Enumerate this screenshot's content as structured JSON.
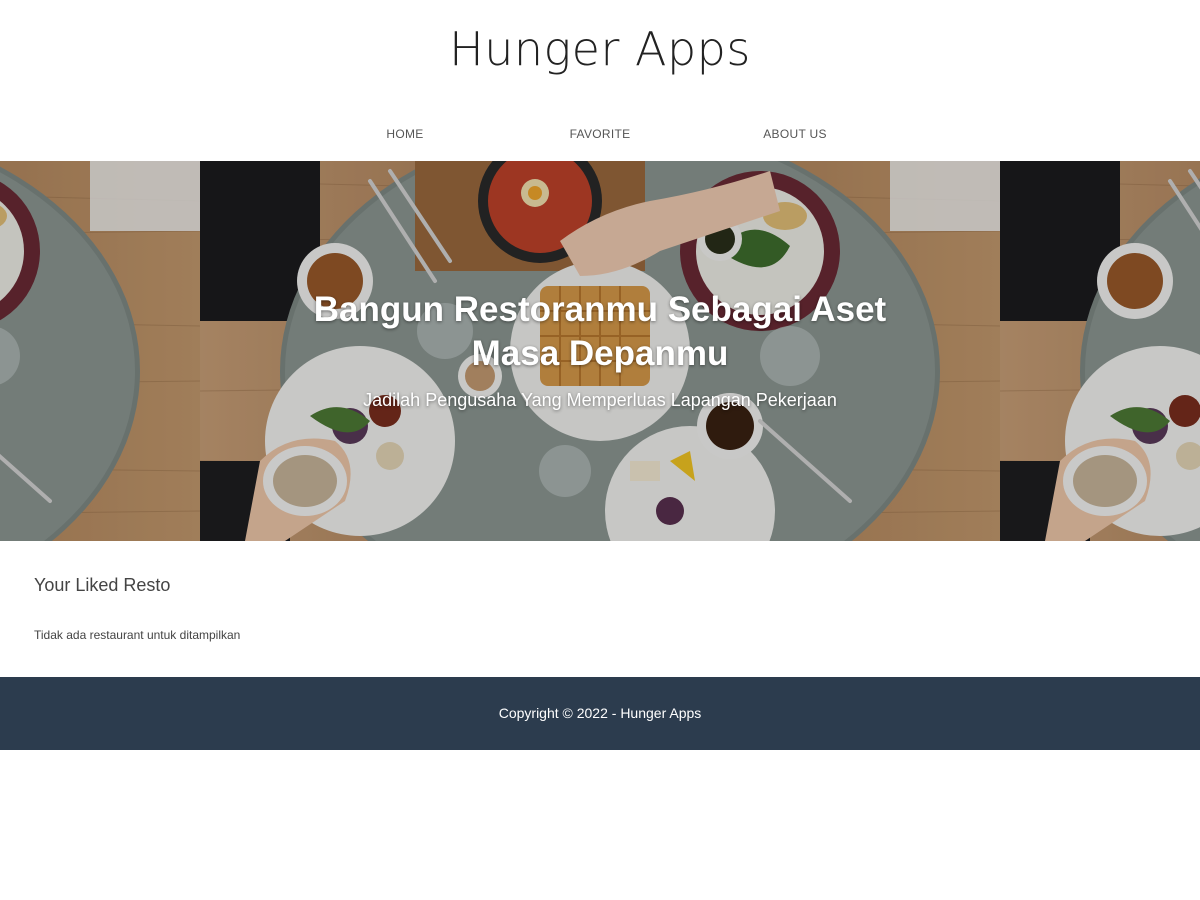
{
  "header": {
    "title": "Hunger Apps"
  },
  "nav": {
    "items": [
      {
        "label": "HOME"
      },
      {
        "label": "FAVORITE"
      },
      {
        "label": "ABOUT US"
      }
    ]
  },
  "hero": {
    "title": "Bangun Restoranmu Sebagai Aset Masa Depanmu",
    "subtitle": "Jadilah Pengusaha Yang Memperluas Lapangan Pekerjaan"
  },
  "main": {
    "heading": "Your Liked Resto",
    "empty_message": "Tidak ada restaurant untuk ditampilkan"
  },
  "footer": {
    "text": "Copyright © 2022 - Hunger Apps"
  },
  "colors": {
    "footer_bg": "#2c3c4e",
    "hero_table": "#8a9490",
    "wood": "#b98c60"
  }
}
